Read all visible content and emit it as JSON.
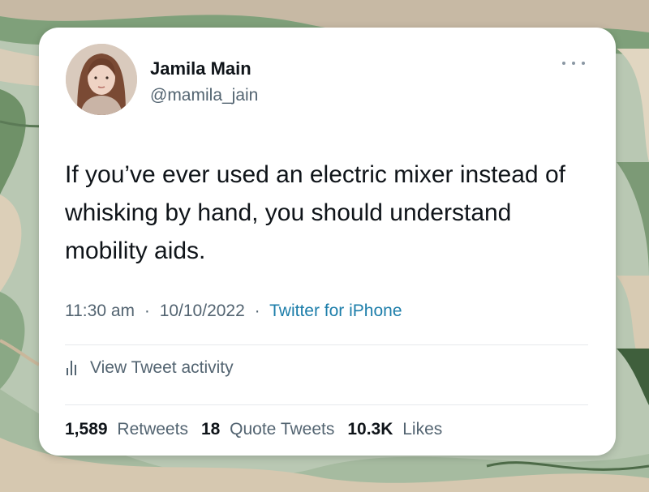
{
  "tweet": {
    "display_name": "Jamila Main",
    "handle": "@mamila_jain",
    "text": "If you’ve ever used an electric mixer instead of whisking by hand, you should understand mobility aids.",
    "time": "11:30 am",
    "separator": "·",
    "date": "10/10/2022",
    "source": "Twitter for iPhone"
  },
  "activity": {
    "label": "View Tweet activity",
    "icon": "bar-chart-icon"
  },
  "menu": {
    "icon": "more-options-icon"
  },
  "stats": {
    "retweets_count": "1,589",
    "retweets_label": "Retweets",
    "quotes_count": "18",
    "quotes_label": "Quote Tweets",
    "likes_count": "10.3K",
    "likes_label": "Likes"
  },
  "colors": {
    "text_primary": "#0f1419",
    "text_secondary": "#536471",
    "link": "#1d7eaa",
    "card_bg": "#ffffff",
    "background_marble_green": "#8fae8a"
  }
}
